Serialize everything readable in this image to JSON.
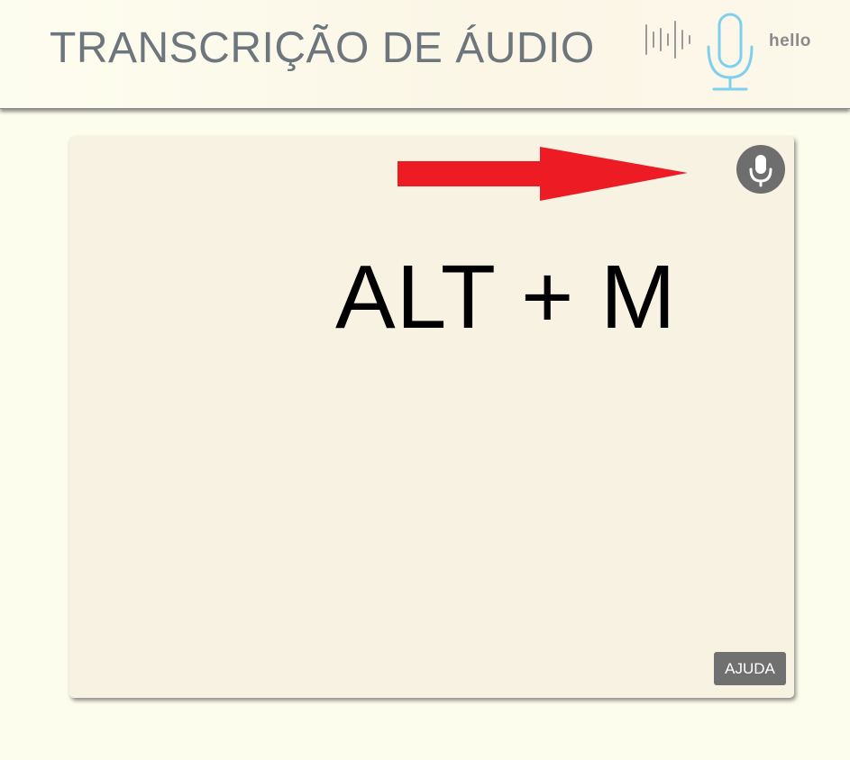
{
  "header": {
    "title": "TRANSCRIÇÃO DE ÁUDIO",
    "logo": {
      "word": "hello",
      "icon": "microphone-soundwave-logo",
      "wave_color": "#9a9a9a",
      "mic_color": "#7fd0ee"
    }
  },
  "card": {
    "mic_button": {
      "icon": "microphone-icon",
      "color": "#6e6e6e"
    },
    "arrow": {
      "icon": "arrow-right-icon",
      "color": "#ec1b24"
    },
    "shortcut_text": "ALT + M",
    "help_button_label": "AJUDA"
  }
}
